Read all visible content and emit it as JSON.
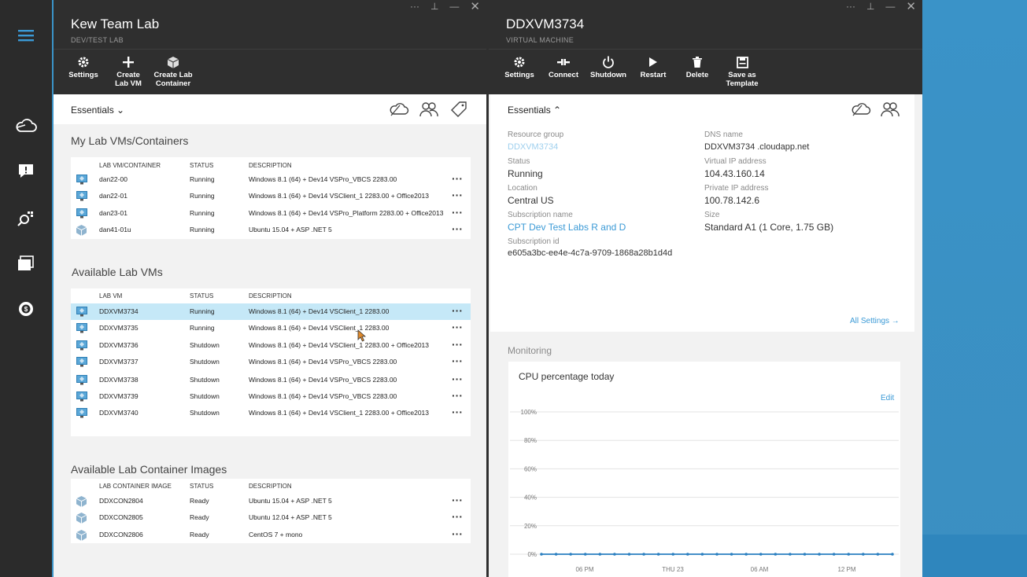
{
  "left_blade": {
    "title": "Kew Team Lab",
    "subtitle": "DEV/TEST LAB",
    "commands": [
      {
        "label": "Settings",
        "icon": "gear-icon"
      },
      {
        "label": "Create Lab VM",
        "icon": "plus-icon"
      },
      {
        "label": "Create Lab Container",
        "icon": "cube-icon"
      }
    ],
    "essentials_label": "Essentials",
    "my_section": {
      "title": "My Lab VMs/Containers",
      "headers": [
        "LAB VM/CONTAINER",
        "STATUS",
        "DESCRIPTION"
      ],
      "rows": [
        {
          "name": "dan22-00",
          "status": "Running",
          "desc": "Windows 8.1 (64) + Dev14 VSPro_VBCS 2283.00",
          "icon": "vm-icon"
        },
        {
          "name": "dan22-01",
          "status": "Running",
          "desc": "Windows 8.1 (64) + Dev14 VSClient_1 2283.00 + Office2013",
          "icon": "vm-icon"
        },
        {
          "name": "dan23-01",
          "status": "Running",
          "desc": "Windows 8.1 (64) + Dev14 VSPro_Platform 2283.00 + Office2013",
          "icon": "vm-icon"
        },
        {
          "name": "dan41-01u",
          "status": "Running",
          "desc": "Ubuntu 15.04 + ASP .NET 5",
          "icon": "container-icon"
        }
      ]
    },
    "avail_section": {
      "title": "Available Lab VMs",
      "headers": [
        "LAB VM",
        "STATUS",
        "DESCRIPTION"
      ],
      "rows": [
        {
          "name": "DDXVM3734",
          "status": "Running",
          "desc": "Windows 8.1 (64) + Dev14 VSClient_1 2283.00"
        },
        {
          "name": "DDXVM3735",
          "status": "Running",
          "desc": "Windows 8.1 (64) + Dev14 VSClient_1 2283.00"
        },
        {
          "name": "DDXVM3736",
          "status": "Shutdown",
          "desc": "Windows 8.1 (64) + Dev14 VSClient_1 2283.00 + Office2013"
        },
        {
          "name": "DDXVM3737",
          "status": "Shutdown",
          "desc": "Windows 8.1 (64) + Dev14 VSPro_VBCS 2283.00"
        },
        {
          "name": "DDXVM3738",
          "status": "Shutdown",
          "desc": "Windows 8.1 (64) + Dev14 VSPro_VBCS 2283.00"
        },
        {
          "name": "DDXVM3739",
          "status": "Shutdown",
          "desc": "Windows 8.1 (64) + Dev14 VSPro_VBCS 2283.00"
        },
        {
          "name": "DDXVM3740",
          "status": "Shutdown",
          "desc": "Windows 8.1 (64) + Dev14 VSClient_1 2283.00 + Office2013"
        }
      ]
    },
    "container_section": {
      "title": "Available Lab Container Images",
      "headers": [
        "LAB CONTAINER IMAGE",
        "STATUS",
        "DESCRIPTION"
      ],
      "rows": [
        {
          "name": "DDXCON2804",
          "status": "Ready",
          "desc": "Ubuntu 15.04 + ASP .NET 5"
        },
        {
          "name": "DDXCON2805",
          "status": "Ready",
          "desc": "Ubuntu 12.04 + ASP .NET 5"
        },
        {
          "name": "DDXCON2806",
          "status": "Ready",
          "desc": "CentOS 7 + mono"
        }
      ]
    }
  },
  "right_blade": {
    "title": "DDXVM3734",
    "subtitle": "VIRTUAL MACHINE",
    "commands": [
      {
        "label": "Settings",
        "icon": "gear-icon"
      },
      {
        "label": "Connect",
        "icon": "connect-icon"
      },
      {
        "label": "Shutdown",
        "icon": "power-icon"
      },
      {
        "label": "Restart",
        "icon": "play-icon"
      },
      {
        "label": "Delete",
        "icon": "trash-icon"
      },
      {
        "label": "Save as Template",
        "icon": "save-icon"
      }
    ],
    "essentials_label": "Essentials",
    "props_left": [
      {
        "label": "Resource group",
        "value": "DDXVM3734"
      },
      {
        "label": "Status",
        "value": "Running"
      },
      {
        "label": "Location",
        "value": "Central US"
      },
      {
        "label": "Subscription name",
        "value": "CPT Dev Test Labs R and D"
      },
      {
        "label": "Subscription id",
        "value": "e605a3bc-ee4e-4c7a-9709-1868a28b1d4d"
      }
    ],
    "props_right": [
      {
        "label": "DNS name",
        "value": "DDXVM3734 .cloudapp.net"
      },
      {
        "label": "Virtual IP address",
        "value": "104.43.160.14"
      },
      {
        "label": "Private IP address",
        "value": "100.78.142.6"
      },
      {
        "label": "Size",
        "value": "Standard A1 (1 Core, 1.75 GB)"
      }
    ],
    "all_settings": "All Settings →",
    "monitoring_label": "Monitoring",
    "chart_title": "CPU percentage today",
    "edit_label": "Edit"
  },
  "chart_data": {
    "type": "line",
    "title": "CPU percentage today",
    "y_ticks": [
      "100%",
      "80%",
      "60%",
      "40%",
      "20%",
      "0%"
    ],
    "x_ticks": [
      "06 PM",
      "THU 23",
      "06 AM",
      "12 PM"
    ],
    "ylim": [
      0,
      100
    ],
    "series": [
      {
        "values": [
          0,
          0,
          0,
          0,
          0,
          0,
          0,
          0,
          0,
          0,
          0,
          0,
          0,
          0,
          0,
          0,
          0,
          0,
          0,
          0,
          0,
          0,
          0,
          0,
          0
        ]
      }
    ],
    "grid": true,
    "color": "#2a7fc0"
  },
  "colors": {
    "accent": "#3b9ad6",
    "selected_row": "#c5e8f7",
    "header": "#2f2f2f"
  }
}
